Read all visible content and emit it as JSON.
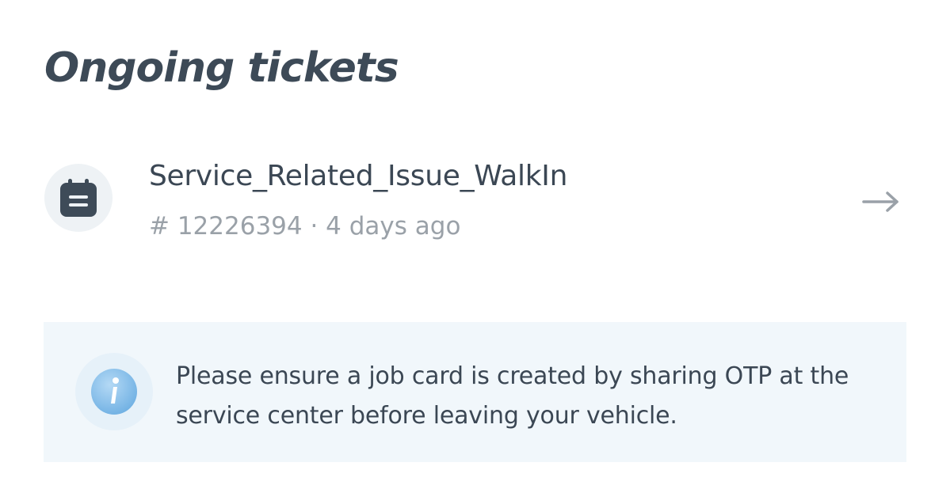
{
  "header": {
    "title": "Ongoing tickets"
  },
  "tickets": [
    {
      "title": "Service_Related_Issue_WalkIn",
      "meta": "# 12226394 · 4 days ago",
      "icon": "calendar-icon",
      "action_icon": "arrow-right-icon"
    }
  ],
  "info_banner": {
    "icon": "info-icon",
    "text": "Please ensure a job card is created by sharing OTP at the service center before leaving your vehicle."
  },
  "colors": {
    "text_primary": "#3b4754",
    "text_secondary": "#9aa1a8",
    "banner_background": "#f1f7fb",
    "info_icon_blue": "#8fc2ec"
  }
}
